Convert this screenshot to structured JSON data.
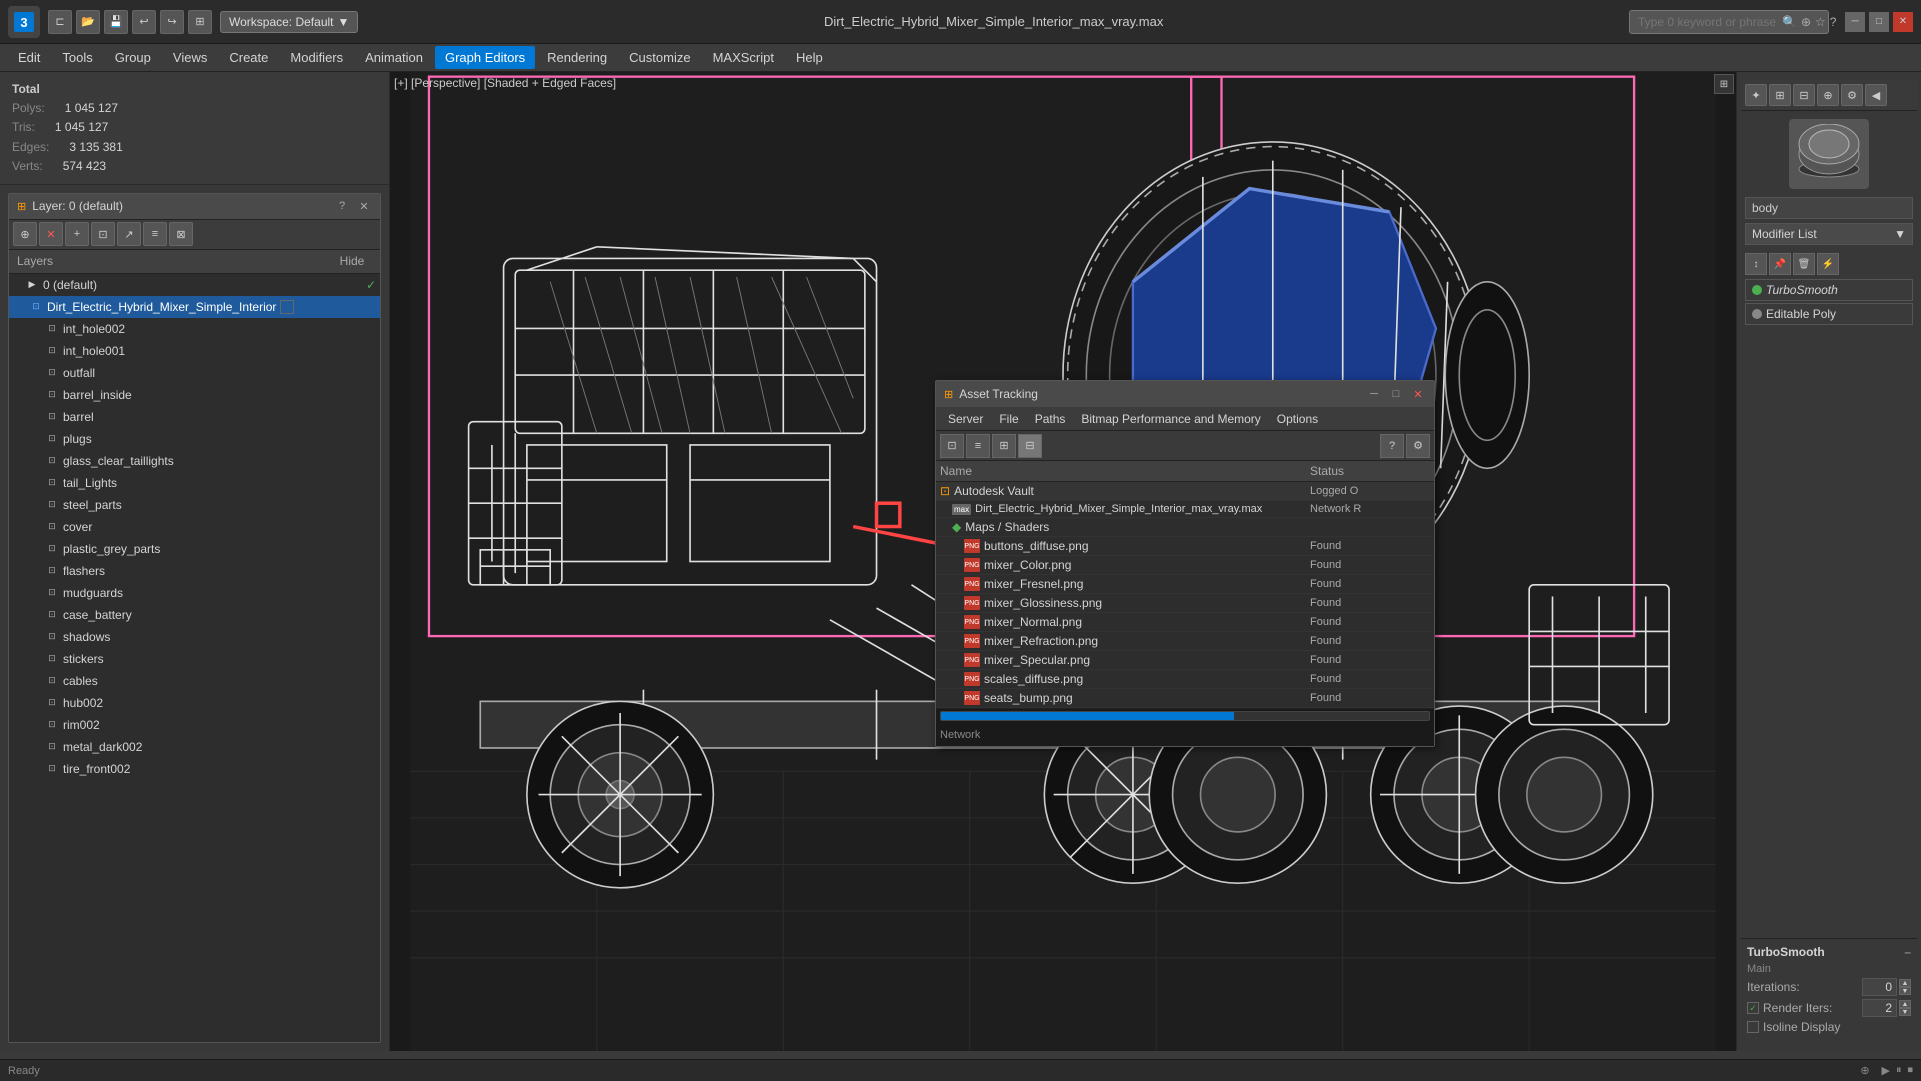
{
  "app": {
    "logo": "3",
    "workspace_label": "Workspace: Default",
    "file_title": "Dirt_Electric_Hybrid_Mixer_Simple_Interior_max_vray.max",
    "search_placeholder": "Type 0 keyword or phrase"
  },
  "toolbar": {
    "buttons": [
      "⊏",
      "⊐",
      "💾",
      "↩",
      "↪",
      "⊞"
    ]
  },
  "menu": {
    "items": [
      "Edit",
      "Tools",
      "Group",
      "Views",
      "Create",
      "Modifiers",
      "Animation",
      "Graph Editors",
      "Rendering",
      "Customize",
      "MAXScript",
      "Help"
    ]
  },
  "viewport_label": "[+] [Perspective] [Shaded + Edged Faces]",
  "stats": {
    "total_label": "Total",
    "polys_label": "Polys:",
    "polys_value": "1 045 127",
    "tris_label": "Tris:",
    "tris_value": "1 045 127",
    "edges_label": "Edges:",
    "edges_value": "3 135 381",
    "verts_label": "Verts:",
    "verts_value": "574 423"
  },
  "layer_manager": {
    "title": "Layer: 0 (default)",
    "layers_header": "Layers",
    "hide_header": "Hide",
    "items": [
      {
        "id": "default",
        "name": "0 (default)",
        "level": 0,
        "checked": true
      },
      {
        "id": "mixer",
        "name": "Dirt_Electric_Hybrid_Mixer_Simple_Interior",
        "level": 1,
        "selected": true
      },
      {
        "id": "int_hole002",
        "name": "int_hole002",
        "level": 2
      },
      {
        "id": "int_hole001",
        "name": "int_hole001",
        "level": 2
      },
      {
        "id": "outfall",
        "name": "outfall",
        "level": 2
      },
      {
        "id": "barrel_inside",
        "name": "barrel_inside",
        "level": 2
      },
      {
        "id": "barrel",
        "name": "barrel",
        "level": 2
      },
      {
        "id": "plugs",
        "name": "plugs",
        "level": 2
      },
      {
        "id": "glass_clear_taillights",
        "name": "glass_clear_taillights",
        "level": 2
      },
      {
        "id": "tail_Lights",
        "name": "tail_Lights",
        "level": 2
      },
      {
        "id": "steel_parts",
        "name": "steel_parts",
        "level": 2
      },
      {
        "id": "cover",
        "name": "cover",
        "level": 2
      },
      {
        "id": "plastic_grey_parts",
        "name": "plastic_grey_parts",
        "level": 2
      },
      {
        "id": "flashers",
        "name": "flashers",
        "level": 2
      },
      {
        "id": "mudguards",
        "name": "mudguards",
        "level": 2
      },
      {
        "id": "case_battery",
        "name": "case_battery",
        "level": 2
      },
      {
        "id": "shadows",
        "name": "shadows",
        "level": 2
      },
      {
        "id": "stickers",
        "name": "stickers",
        "level": 2
      },
      {
        "id": "cables",
        "name": "cables",
        "level": 2
      },
      {
        "id": "hub002",
        "name": "hub002",
        "level": 2
      },
      {
        "id": "rim002",
        "name": "rim002",
        "level": 2
      },
      {
        "id": "metal_dark002",
        "name": "metal_dark002",
        "level": 2
      },
      {
        "id": "tire_front002",
        "name": "tire_front002",
        "level": 2
      }
    ]
  },
  "modifier_panel": {
    "search_placeholder": "body",
    "modifier_list_label": "Modifier List",
    "stack": [
      {
        "name": "TurboSmooth",
        "type": "smooth",
        "italic": true
      },
      {
        "name": "Editable Poly",
        "type": "poly"
      }
    ]
  },
  "turbo_smooth": {
    "title": "TurboSmooth",
    "main_label": "Main",
    "iterations_label": "Iterations:",
    "iterations_value": "0",
    "render_iters_label": "Render Iters:",
    "render_iters_value": "2",
    "isoline_label": "Isoline Display",
    "isoline_checked": false,
    "iterations_checked": true
  },
  "asset_tracking": {
    "title": "Asset Tracking",
    "menus": [
      "Server",
      "File",
      "Paths",
      "Bitmap Performance and Memory",
      "Options"
    ],
    "table_headers": {
      "name": "Name",
      "status": "Status"
    },
    "rows": [
      {
        "id": "vault",
        "name": "Autodesk Vault",
        "level": 0,
        "icon": "vault",
        "status": "Logged O"
      },
      {
        "id": "mixer_file",
        "name": "Dirt_Electric_Hybrid_Mixer_Simple_Interior_max_vray.max",
        "level": 1,
        "icon": "max",
        "status": "Network R"
      },
      {
        "id": "maps",
        "name": "Maps / Shaders",
        "level": 2,
        "icon": "maps",
        "status": ""
      },
      {
        "id": "buttons_diffuse",
        "name": "buttons_diffuse.png",
        "level": 3,
        "icon": "png",
        "status": "Found"
      },
      {
        "id": "mixer_color",
        "name": "mixer_Color.png",
        "level": 3,
        "icon": "png",
        "status": "Found"
      },
      {
        "id": "mixer_fresnel",
        "name": "mixer_Fresnel.png",
        "level": 3,
        "icon": "png",
        "status": "Found"
      },
      {
        "id": "mixer_glossiness",
        "name": "mixer_Glossiness.png",
        "level": 3,
        "icon": "png",
        "status": "Found"
      },
      {
        "id": "mixer_normal",
        "name": "mixer_Normal.png",
        "level": 3,
        "icon": "png",
        "status": "Found"
      },
      {
        "id": "mixer_refraction",
        "name": "mixer_Refraction.png",
        "level": 3,
        "icon": "png",
        "status": "Found"
      },
      {
        "id": "mixer_specular",
        "name": "mixer_Specular.png",
        "level": 3,
        "icon": "png",
        "status": "Found"
      },
      {
        "id": "scales_diffuse",
        "name": "scales_diffuse.png",
        "level": 3,
        "icon": "png",
        "status": "Found"
      },
      {
        "id": "seats_bump",
        "name": "seats_bump.png",
        "level": 3,
        "icon": "png",
        "status": "Found"
      }
    ]
  },
  "status_bar": {
    "network_label": "Network"
  },
  "colors": {
    "selected_blue": "#1e5a9c",
    "found_green": "#4CAF50",
    "accent_blue": "#0078d4"
  }
}
